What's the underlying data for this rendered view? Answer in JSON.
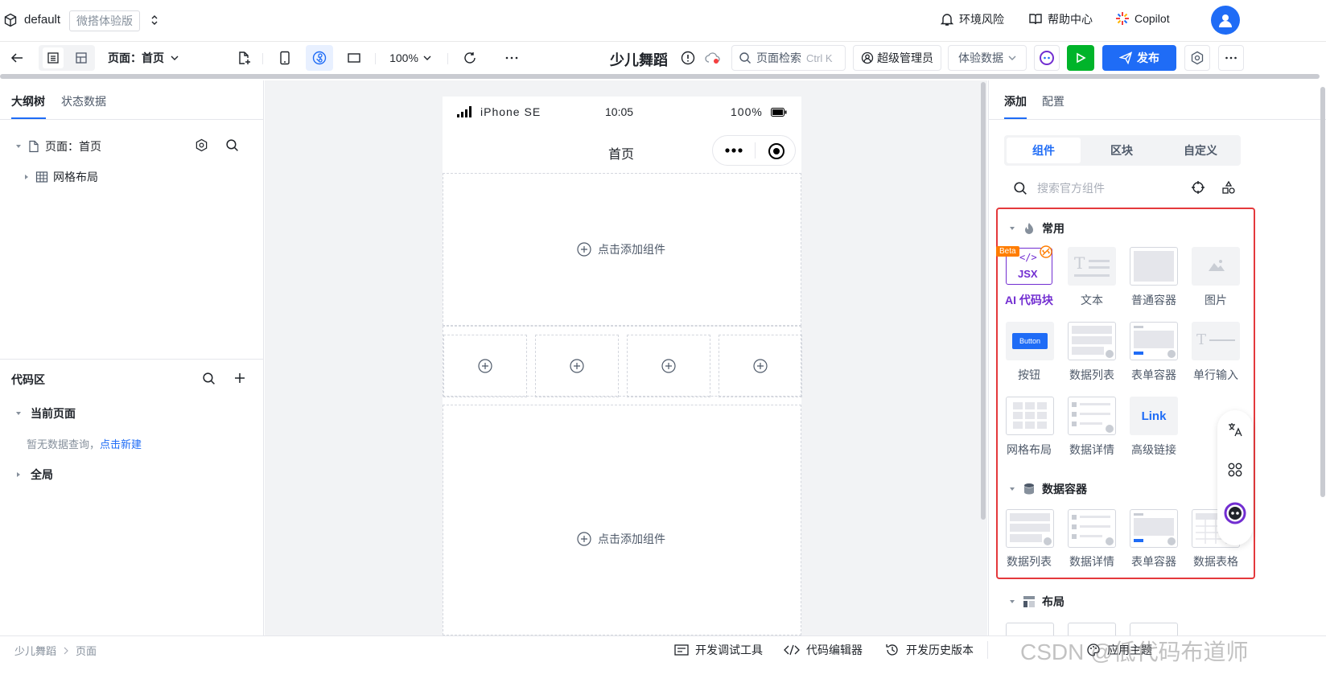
{
  "topbar": {
    "app_name": "default",
    "badge": "微搭体验版",
    "risk": "环境风险",
    "help": "帮助中心",
    "copilot": "Copilot"
  },
  "toolbar": {
    "page_selector": "页面：首页",
    "zoom": "100%",
    "app_title": "少儿舞蹈",
    "search_placeholder": "页面检索",
    "search_shortcut": "Ctrl K",
    "role": "超级管理员",
    "data_mode": "体验数据",
    "publish": "发布"
  },
  "left_panel": {
    "tabs": [
      "大纲树",
      "状态数据"
    ],
    "tree": {
      "page": "页面：首页",
      "child": "网格布局"
    },
    "code_title": "代码区",
    "current_page": "当前页面",
    "empty_text": "暂无数据查询，",
    "new_link": "点击新建",
    "global": "全局"
  },
  "phone": {
    "device": "iPhone SE",
    "time": "10:05",
    "battery": "100%",
    "title": "首页",
    "add_component": "点击添加组件"
  },
  "right_panel": {
    "tabs": [
      "添加",
      "配置"
    ],
    "segments": [
      "组件",
      "区块",
      "自定义"
    ],
    "search_placeholder": "搜索官方组件",
    "common": {
      "title": "常用",
      "beta": "Beta",
      "items": [
        "AI 代码块",
        "文本",
        "普通容器",
        "图片",
        "按钮",
        "数据列表",
        "表单容器",
        "单行输入",
        "网格布局",
        "数据详情",
        "高级链接"
      ]
    },
    "data_container": {
      "title": "数据容器",
      "items": [
        "数据列表",
        "数据详情",
        "表单容器",
        "数据表格"
      ]
    },
    "layout_title": "布局",
    "jsx_text": "JSX",
    "button_text": "Button",
    "link_text": "Link"
  },
  "statusbar": {
    "breadcrumb": [
      "少儿舞蹈",
      "页面"
    ],
    "devtools": "开发调试工具",
    "code_editor": "代码编辑器",
    "history": "开发历史版本",
    "theme": "应用主题",
    "watermark": "CSDN @低代码布道师"
  },
  "colors": {
    "accent": "#1f6cf6",
    "highlight": "#e4393c",
    "green": "#00b42a",
    "ai_purple": "#722ed1",
    "beta": "#ff7d00"
  }
}
